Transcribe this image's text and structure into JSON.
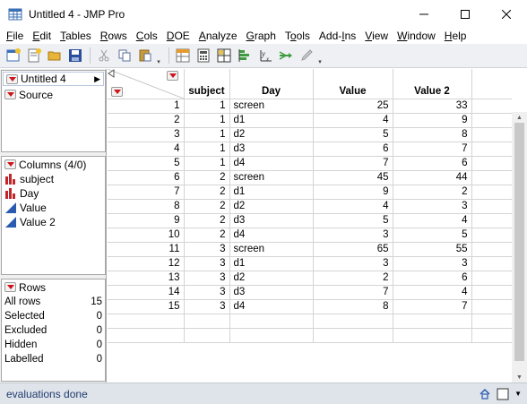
{
  "window": {
    "title": "Untitled 4 - JMP Pro"
  },
  "menu": [
    "File",
    "Edit",
    "Tables",
    "Rows",
    "Cols",
    "DOE",
    "Analyze",
    "Graph",
    "Tools",
    "Add-Ins",
    "View",
    "Window",
    "Help"
  ],
  "menu_mnemonics": [
    0,
    0,
    0,
    0,
    0,
    0,
    0,
    0,
    1,
    4,
    0,
    0,
    0
  ],
  "panels": {
    "table_name": "Untitled 4",
    "source_label": "Source",
    "columns_title": "Columns (4/0)",
    "columns": [
      {
        "name": "subject",
        "icon": "nominal-bar-icon"
      },
      {
        "name": "Day",
        "icon": "nominal-bar-icon"
      },
      {
        "name": "Value",
        "icon": "continuous-triangle-icon"
      },
      {
        "name": "Value 2",
        "icon": "continuous-triangle-icon"
      }
    ],
    "rows_title": "Rows",
    "rows_summary": [
      {
        "label": "All rows",
        "value": "15"
      },
      {
        "label": "Selected",
        "value": "0"
      },
      {
        "label": "Excluded",
        "value": "0"
      },
      {
        "label": "Hidden",
        "value": "0"
      },
      {
        "label": "Labelled",
        "value": "0"
      }
    ]
  },
  "grid": {
    "headers": [
      "subject",
      "Day",
      "Value",
      "Value 2"
    ],
    "rows": [
      [
        "1",
        "1",
        "screen",
        "25",
        "33"
      ],
      [
        "2",
        "1",
        "d1",
        "4",
        "9"
      ],
      [
        "3",
        "1",
        "d2",
        "5",
        "8"
      ],
      [
        "4",
        "1",
        "d3",
        "6",
        "7"
      ],
      [
        "5",
        "1",
        "d4",
        "7",
        "6"
      ],
      [
        "6",
        "2",
        "screen",
        "45",
        "44"
      ],
      [
        "7",
        "2",
        "d1",
        "9",
        "2"
      ],
      [
        "8",
        "2",
        "d2",
        "4",
        "3"
      ],
      [
        "9",
        "2",
        "d3",
        "5",
        "4"
      ],
      [
        "10",
        "2",
        "d4",
        "3",
        "5"
      ],
      [
        "11",
        "3",
        "screen",
        "65",
        "55"
      ],
      [
        "12",
        "3",
        "d1",
        "3",
        "3"
      ],
      [
        "13",
        "3",
        "d2",
        "2",
        "6"
      ],
      [
        "14",
        "3",
        "d3",
        "7",
        "4"
      ],
      [
        "15",
        "3",
        "d4",
        "8",
        "7"
      ]
    ]
  },
  "status": {
    "text": "evaluations done"
  },
  "colors": {
    "red_triangle": "#d0141b",
    "nominal_icon": "#c0262b",
    "continuous_icon": "#2a5bb0",
    "status_text": "#1f3b6e"
  }
}
